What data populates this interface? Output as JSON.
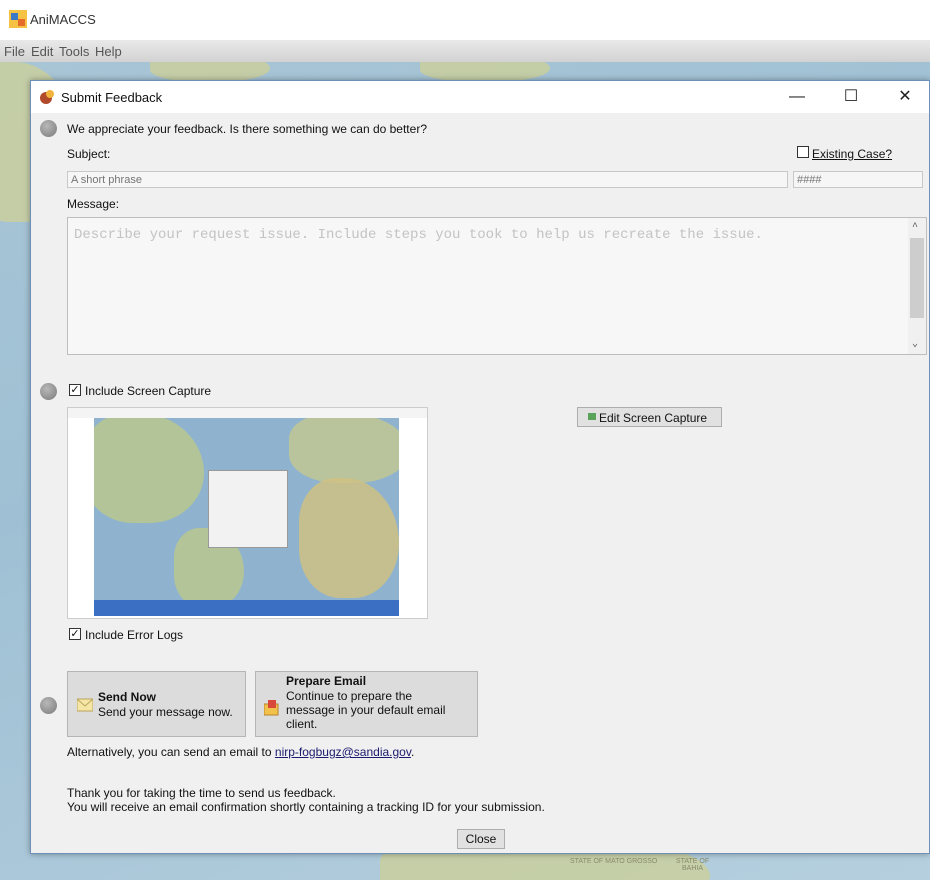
{
  "app": {
    "title": "AniMACCS"
  },
  "menu": [
    "File",
    "Edit",
    "Tools",
    "Help"
  ],
  "dialog": {
    "title": "Submit Feedback",
    "controls": {
      "minimize": "—",
      "maximize": "☐",
      "close": "✕"
    },
    "intro": "We appreciate your feedback. Is there something we can do better?",
    "subject_label": "Subject:",
    "subject_placeholder": "A short phrase",
    "existing_case_label": "Existing Case?",
    "case_placeholder": "####",
    "message_label": "Message:",
    "message_placeholder": "Describe your request issue. Include steps you took to help us recreate the issue.",
    "include_capture_label": "Include Screen Capture",
    "include_capture_checked": true,
    "edit_capture_label": "Edit Screen Capture",
    "include_logs_label": "Include Error Logs",
    "include_logs_checked": true,
    "send_now": {
      "title": "Send Now",
      "desc": "Send your message now."
    },
    "prepare_email": {
      "title": "Prepare Email",
      "desc_lines": [
        "Continue to prepare the",
        "message in your default email",
        "client."
      ]
    },
    "alt_text": "Alternatively, you can send an email to",
    "alt_email": "nirp-fogbugz@sandia.gov",
    "alt_period": ".",
    "thanks_line1": "Thank you for taking the time to send us feedback.",
    "thanks_line2": "You will receive an email confirmation shortly containing a tracking ID for your submission.",
    "close_label": "Close"
  },
  "map_labels": [
    "STATE OF MATO GROSSO",
    "STATE OF BAHIA"
  ],
  "colors": {
    "accent_border": "#6d8fb8",
    "taskbar": "#3a6fc4",
    "ocean": "#a8c5d6"
  }
}
